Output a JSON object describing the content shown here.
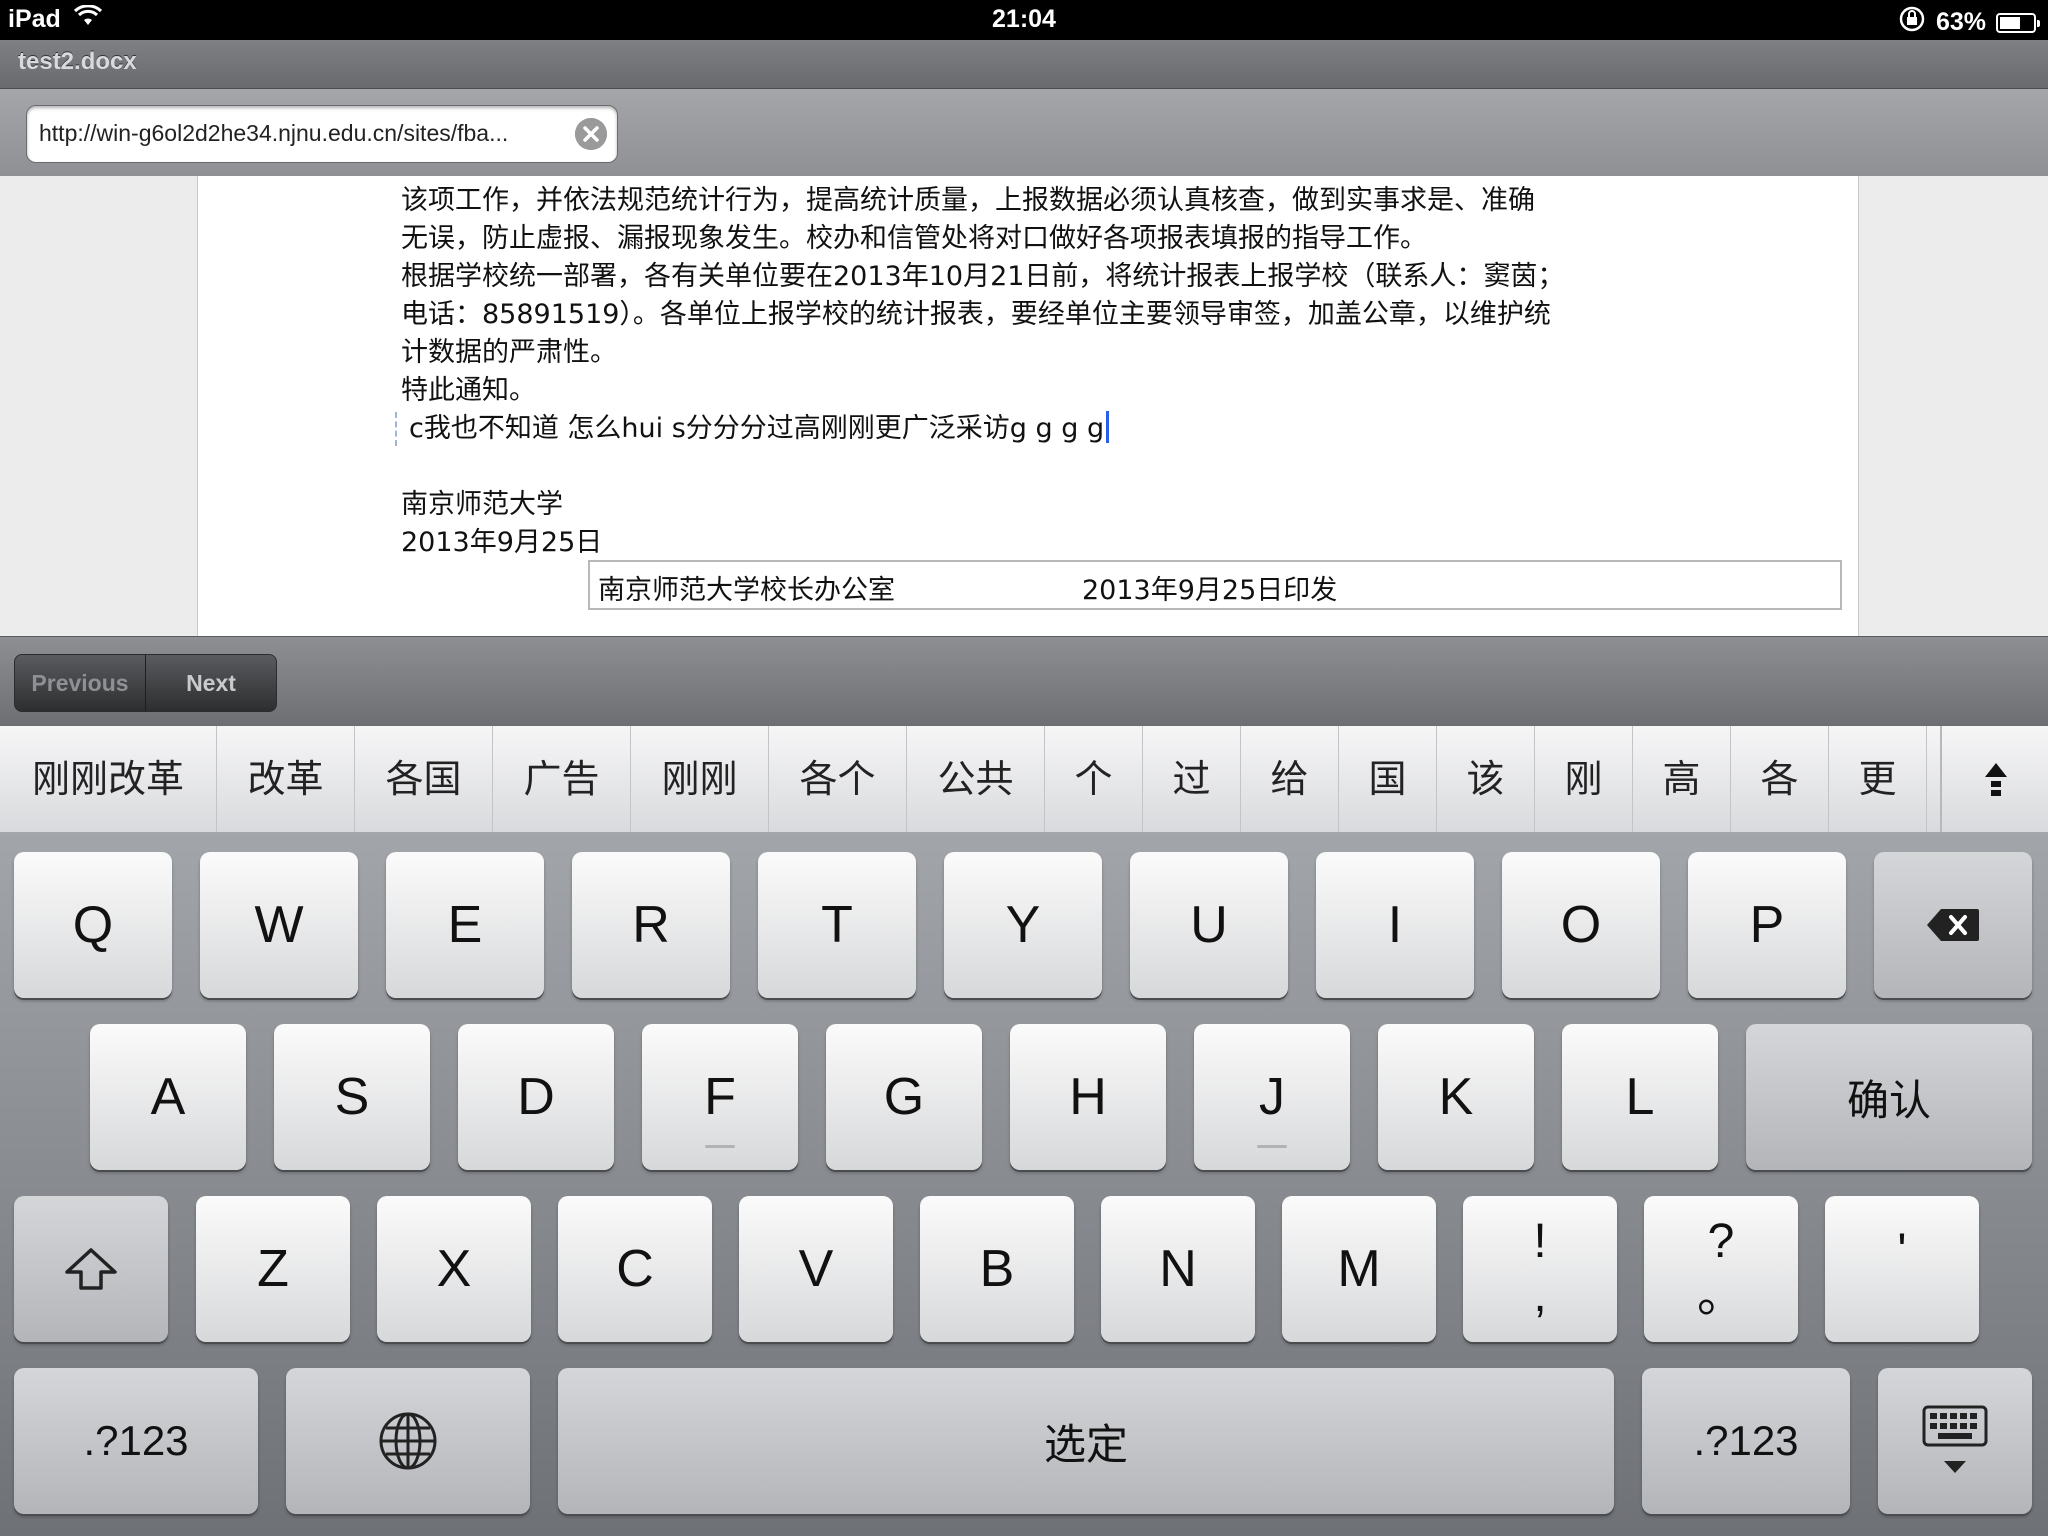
{
  "status": {
    "device": "iPad",
    "time": "21:04",
    "battery": "63%",
    "battery_level": 0.63
  },
  "window": {
    "title": "test2.docx"
  },
  "urlbar": {
    "url": "http://win-g6ol2d2he34.njnu.edu.cn/sites/fba..."
  },
  "document": {
    "lines": [
      "该项工作，并依法规范统计行为，提高统计质量，上报数据必须认真核查，做到实事求是、准确",
      "无误，防止虚报、漏报现象发生。校办和信管处将对口做好各项报表填报的指导工作。",
      "根据学校统一部署，各有关单位要在2013年10月21日前，将统计报表上报学校（联系人：窦茵；",
      "电话：85891519）。各单位上报学校的统计报表，要经单位主要领导审签，加盖公章，以维护统",
      "计数据的严肃性。",
      "特此通知。"
    ],
    "editing_line": "c我也不知道 怎么hui s分分分过高刚刚更广泛采访g g g g",
    "signature": "南京师范大学",
    "date": "2013年9月25日",
    "footer_left": "南京师范大学校长办公室",
    "footer_right": "2013年9月25日印发"
  },
  "toolbar": {
    "previous": "Previous",
    "next": "Next"
  },
  "candidates": [
    "刚刚改革",
    "改革",
    "各国",
    "广告",
    "刚刚",
    "各个",
    "公共",
    "个",
    "过",
    "给",
    "国",
    "该",
    "刚",
    "高",
    "各",
    "更"
  ],
  "keyboard": {
    "row1": [
      "Q",
      "W",
      "E",
      "R",
      "T",
      "Y",
      "U",
      "I",
      "O",
      "P"
    ],
    "row2": [
      "A",
      "S",
      "D",
      "F",
      "G",
      "H",
      "J",
      "K",
      "L"
    ],
    "confirm": "确认",
    "row3": [
      "Z",
      "X",
      "C",
      "V",
      "B",
      "N",
      "M"
    ],
    "punct1_top": "!",
    "punct1_bottom": ",",
    "punct2_top": "?",
    "punct2_bottom": "。",
    "punct3": "'",
    "numbers_left": ".?123",
    "space": "选定",
    "numbers_right": ".?123"
  }
}
